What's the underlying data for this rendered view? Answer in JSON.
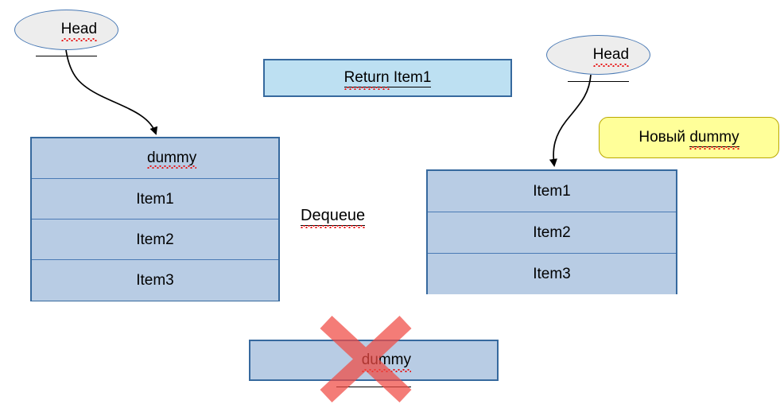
{
  "diagram": {
    "title": "Queue Dequeue operation with dummy node",
    "colors": {
      "stack_fill": "#b8cce4",
      "stack_border": "#36699e",
      "return_fill": "#bde0f2",
      "ellipse_fill": "#ededed",
      "ellipse_border": "#4a7ab5",
      "callout_fill": "#ffff99",
      "gray_arrow_fill": "#d9d9d9",
      "gray_arrow_border": "#4a7ab5",
      "dequeue_arrow_fill": "#b8cce4",
      "delete_cross": "#f7766f",
      "spellcheck_underline": "#e81313"
    }
  },
  "left": {
    "head_label": "Head",
    "cells": [
      {
        "label": "dummy",
        "misspelled": true
      },
      {
        "label": "Item1",
        "misspelled": false
      },
      {
        "label": "Item2",
        "misspelled": false
      },
      {
        "label": "Item3",
        "misspelled": false
      }
    ]
  },
  "right": {
    "head_label": "Head",
    "callout_prefix": "Новый ",
    "callout_word": "dummy",
    "cells": [
      {
        "label": "Item1",
        "misspelled": false
      },
      {
        "label": "Item2",
        "misspelled": false
      },
      {
        "label": "Item3",
        "misspelled": false
      }
    ]
  },
  "middle": {
    "return_prefix": "Return",
    "return_suffix": " Item1",
    "operation_label": "Dequeue",
    "deleted_label": "dummy"
  }
}
